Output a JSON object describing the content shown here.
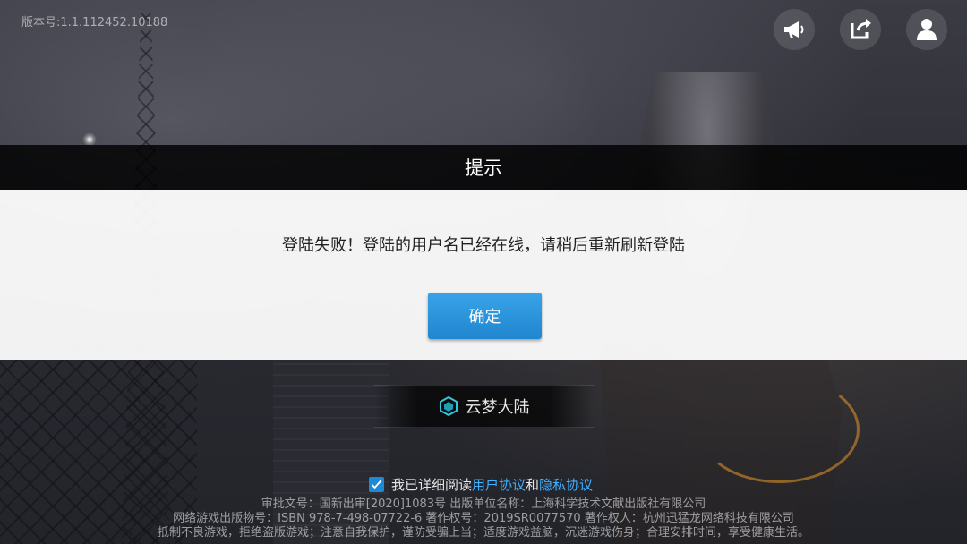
{
  "version_text": "版本号:1.1.112452.10188",
  "top_buttons": [
    {
      "name": "announcement",
      "icon": "megaphone-icon"
    },
    {
      "name": "switch-account",
      "icon": "switch-account-icon"
    },
    {
      "name": "user-center",
      "icon": "user-icon"
    }
  ],
  "dialog": {
    "title": "提示",
    "message": "登陆失败！登陆的用户名已经在线，请稍后重新刷新登陆",
    "confirm_label": "确定"
  },
  "server": {
    "name": "云梦大陆",
    "icon": "hexagon-cube-icon"
  },
  "agreement": {
    "checked": true,
    "prefix": "我已详细阅读",
    "user_agreement": "用户协议",
    "and": "和",
    "privacy_policy": "隐私协议"
  },
  "footer": {
    "line1": "审批文号：国新出审[2020]1083号    出版单位名称：上海科学技术文献出版社有限公司",
    "line2": "网络游戏出版物号：ISBN 978-7-498-07722-6    著作权号：2019SR0077570    著作权人：杭州迅猛龙网络科技有限公司",
    "line3": "抵制不良游戏，拒绝盗版游戏；注意自我保护，谨防受骗上当；适度游戏益脑，沉迷游戏伤身；合理安排时间，享受健康生活。"
  },
  "colors": {
    "dialog_button": "#1f86cf",
    "link": "#3fb1ff",
    "checkbox": "#1d8ad8"
  }
}
